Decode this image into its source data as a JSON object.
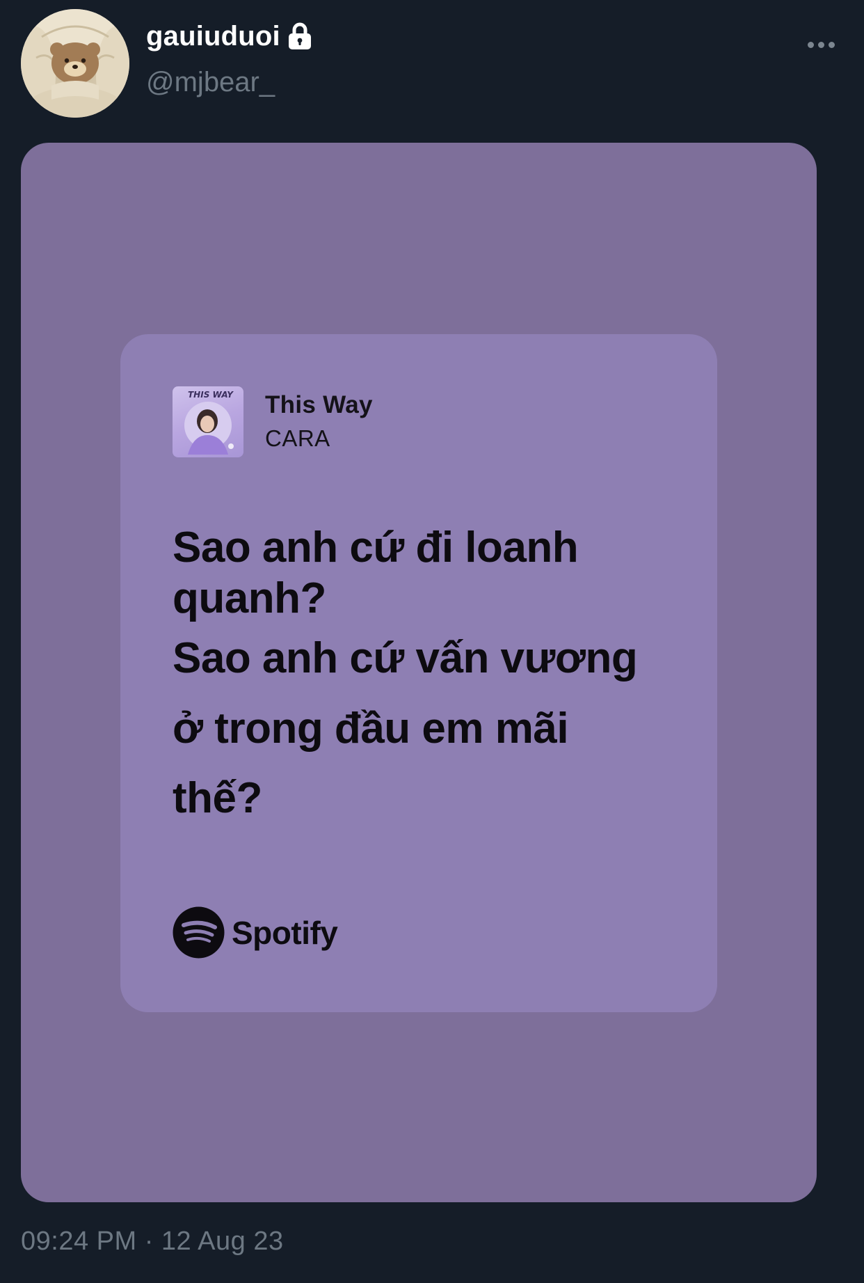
{
  "tweet": {
    "author": {
      "display_name": "gauiuduoi",
      "handle": "@mjbear_",
      "protected": true,
      "avatar_icon": "bear-in-blanket-avatar"
    },
    "more_icon": "more-horizontal-icon",
    "timestamp": "09:24 PM · 12 Aug 23"
  },
  "lyric_card": {
    "song_title": "This Way",
    "artist": "CARA",
    "cover_text": "THIS WAY",
    "lyrics": [
      "Sao anh cứ đi loanh",
      "quanh?",
      "Sao anh cứ vấn vương",
      "ở trong đầu em mãi",
      "thế?"
    ],
    "brand": "Spotify",
    "brand_icon": "spotify-icon"
  },
  "colors": {
    "background": "#151d28",
    "media_background": "#7e6f9a",
    "card_background": "#8e7fb3",
    "secondary_text": "#6d7883",
    "primary_text": "#ffffff"
  }
}
